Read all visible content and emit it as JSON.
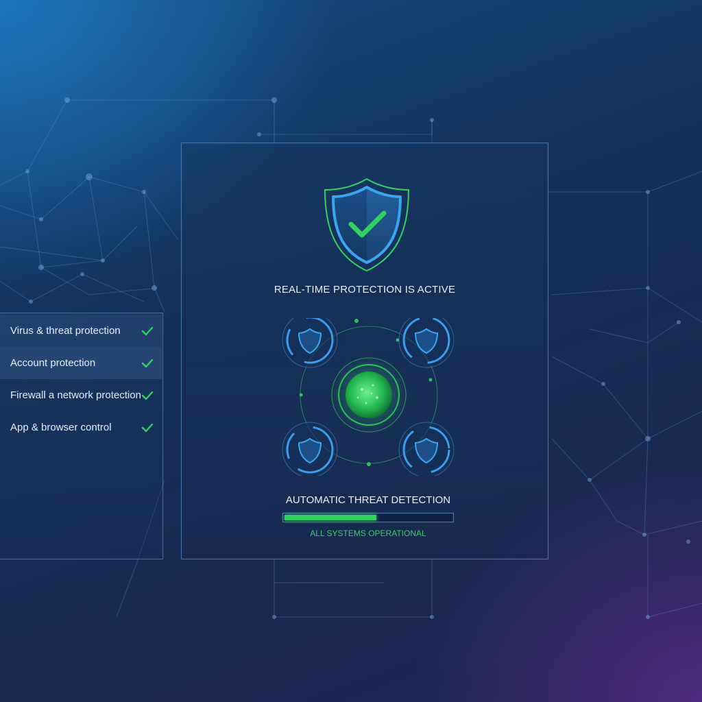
{
  "sidebar": {
    "items": [
      {
        "label": "Virus & threat protection",
        "status_icon": "check-icon"
      },
      {
        "label": "Account protection",
        "status_icon": "check-icon"
      },
      {
        "label": "Firewall a network protection",
        "status_icon": "check-icon"
      },
      {
        "label": "App & browser control",
        "status_icon": "check-icon"
      }
    ],
    "selected_index": 1
  },
  "main": {
    "hero_icon": "shield-check-icon",
    "status_title": "REAL-TIME PROTECTION IS ACTIVE",
    "hub_icons": [
      "shield-icon",
      "shield-icon",
      "shield-icon",
      "shield-icon",
      "scanner-orb-icon"
    ],
    "detection_title": "AUTOMATIC THREAT DETECTION",
    "progress": 0.55,
    "systems_status": "ALL SYSTEMS OPERATIONAL"
  },
  "colors": {
    "accent_green": "#33d25e",
    "accent_blue": "#3a9fe8",
    "panel_border": "#6eaae6"
  }
}
